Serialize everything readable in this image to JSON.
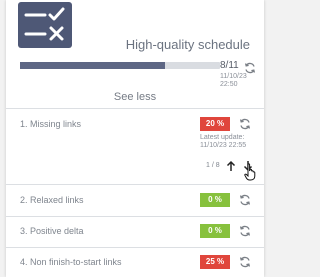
{
  "header": {
    "logo_icon": "schedule-check-icon",
    "title": "High-quality schedule",
    "progress_fraction": 0.727,
    "count": "8/11",
    "date_line1": "11/10/23",
    "date_line2": "22:50",
    "see_less_label": "See less"
  },
  "rows": [
    {
      "label": "1. Missing links",
      "badge": "20 %",
      "badge_color": "#e0463c",
      "latest_update_label": "Latest update:",
      "latest_update_value": "11/10/23 22:55",
      "pager": "1 / 8"
    },
    {
      "label": "2. Relaxed links",
      "badge": "0 %",
      "badge_color": "#87c13d"
    },
    {
      "label": "3. Positive delta",
      "badge": "0 %",
      "badge_color": "#87c13d"
    },
    {
      "label": "4. Non finish-to-start links",
      "badge": "25 %",
      "badge_color": "#e0463c"
    }
  ],
  "icons": {
    "refresh": "refresh-icon",
    "up": "arrow-up-icon",
    "down": "arrow-down-icon",
    "cursor": "hand-pointer-icon"
  }
}
